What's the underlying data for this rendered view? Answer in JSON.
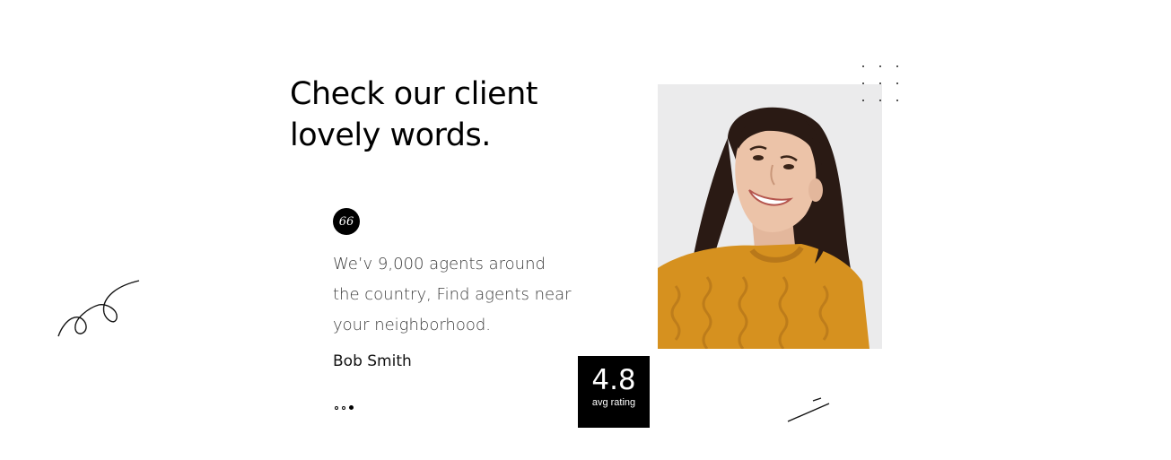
{
  "section": {
    "heading_line1": "Check our client",
    "heading_line2": "lovely words."
  },
  "testimonial": {
    "quote_icon_glyph": "66",
    "text_line1": "We’v 9,000 agents around",
    "text_line2": "the country, Find agents near",
    "text_line3": "your neighborhood.",
    "author": "Bob Smith",
    "pager": {
      "count": 3,
      "active_index": 2
    }
  },
  "rating": {
    "value": "4.8",
    "label": "avg rating"
  },
  "photo": {
    "icon": "client-portrait"
  },
  "colors": {
    "text": "#000000",
    "body_text": "#3d3d3d",
    "badge_bg": "#000000",
    "badge_text": "#ffffff",
    "sweater": "#d6911f",
    "photo_bg": "#ebebec"
  }
}
